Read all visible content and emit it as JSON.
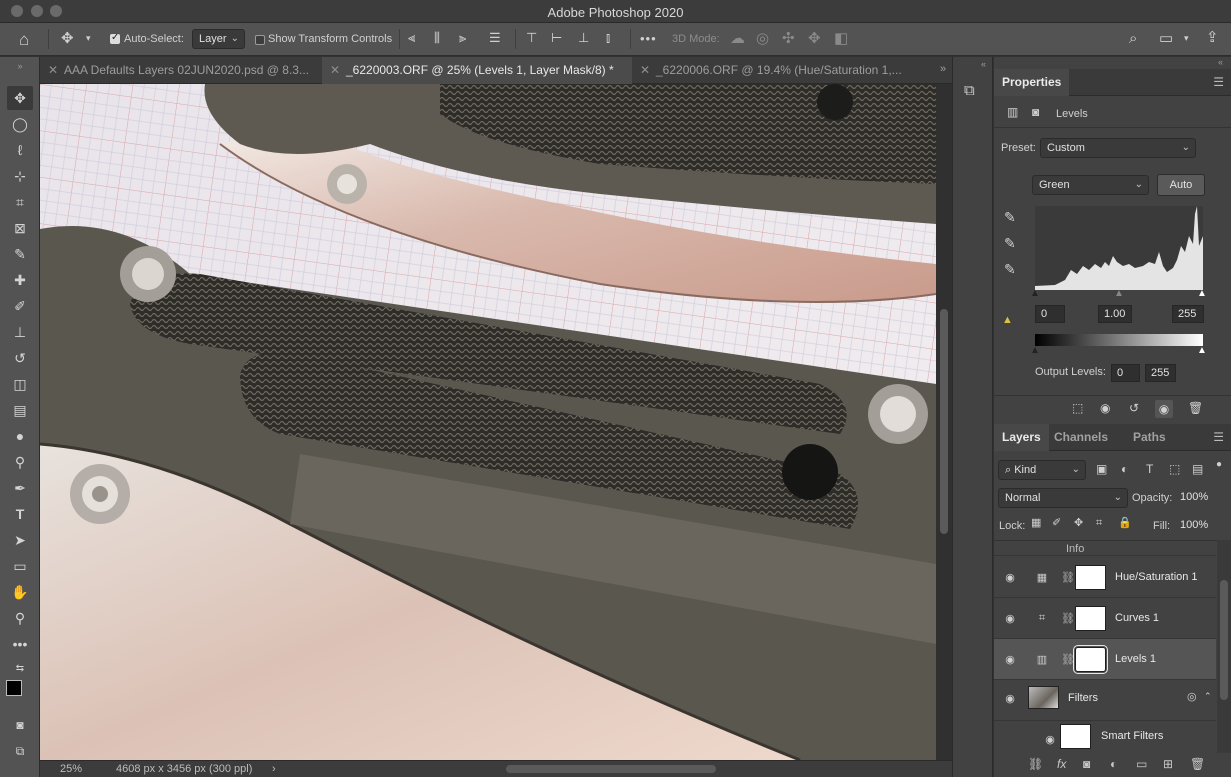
{
  "app": {
    "title": "Adobe Photoshop 2020"
  },
  "options_bar": {
    "auto_select_label": "Auto-Select:",
    "auto_select_checked": true,
    "auto_select_value": "Layer",
    "show_transform_label": "Show Transform Controls",
    "show_transform_checked": false,
    "mode_3d_label": "3D Mode:",
    "more_label": "•••"
  },
  "tabs": [
    {
      "label": "AAA Defaults Layers 02JUN2020.psd @ 8.3...",
      "active": false
    },
    {
      "label": "_6220003.ORF @ 25% (Levels 1, Layer Mask/8) *",
      "active": true
    },
    {
      "label": "_6220006.ORF @ 19.4% (Hue/Saturation 1,...",
      "active": false
    }
  ],
  "status": {
    "zoom": "25%",
    "doc_info": "4608 px x 3456 px (300 ppl)"
  },
  "properties": {
    "title": "Properties",
    "adjustment_name": "Levels",
    "preset_label": "Preset:",
    "preset_value": "Custom",
    "channel_value": "Green",
    "auto_label": "Auto",
    "input_black": "0",
    "input_gamma": "1.00",
    "input_white": "255",
    "output_label": "Output Levels:",
    "output_black": "0",
    "output_white": "255"
  },
  "layers_panel": {
    "tabs": [
      {
        "label": "Layers",
        "active": true
      },
      {
        "label": "Channels",
        "active": false
      },
      {
        "label": "Paths",
        "active": false
      }
    ],
    "filter_kind": "Kind",
    "blend_mode": "Normal",
    "opacity_label": "Opacity:",
    "opacity_value": "100%",
    "lock_label": "Lock:",
    "fill_label": "Fill:",
    "fill_value": "100%",
    "partial_layer": "Info",
    "layers": [
      {
        "name": "Hue/Saturation 1",
        "icon": "hue-saturation-icon",
        "selected": false
      },
      {
        "name": "Curves 1",
        "icon": "curves-icon",
        "selected": false
      },
      {
        "name": "Levels 1",
        "icon": "levels-icon",
        "selected": true
      }
    ],
    "smart_object_name": "Filters",
    "smart_filters_label": "Smart Filters"
  }
}
